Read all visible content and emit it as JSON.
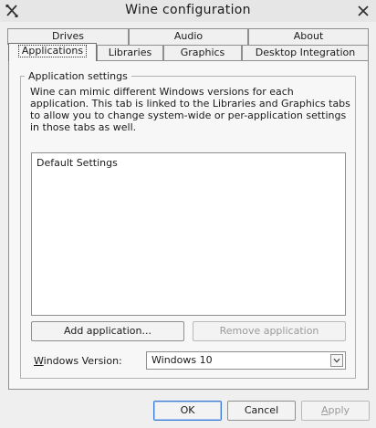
{
  "window": {
    "title": "Wine configuration",
    "icon": "wrench-screwdriver-icon",
    "close_icon": "close-icon"
  },
  "tabs": {
    "row_back": [
      {
        "label": "Drives"
      },
      {
        "label": "Audio"
      },
      {
        "label": "About"
      }
    ],
    "row_front": [
      {
        "label": "Applications",
        "active": true
      },
      {
        "label": "Libraries"
      },
      {
        "label": "Graphics"
      },
      {
        "label": "Desktop Integration"
      }
    ]
  },
  "applications": {
    "group_title": "Application settings",
    "description": "Wine can mimic different Windows versions for each application. This tab is linked to the Libraries and Graphics tabs to allow you to change system-wide or per-application settings in those tabs as well.",
    "list_items": [
      "Default Settings"
    ],
    "add_button": "Add application...",
    "remove_button": "Remove application",
    "version_label_prefix": "W",
    "version_label_rest": "indows Version:",
    "version_value": "Windows 10"
  },
  "footer": {
    "ok": "OK",
    "cancel": "Cancel",
    "apply_prefix": "A",
    "apply_rest": "pply"
  },
  "colors": {
    "window_bg": "#efefef",
    "tab_page_bg": "#f7f7f7",
    "border": "#8f8f8f",
    "default_button_focus": "#3b7bd6",
    "disabled_text": "#9a9a9a"
  }
}
